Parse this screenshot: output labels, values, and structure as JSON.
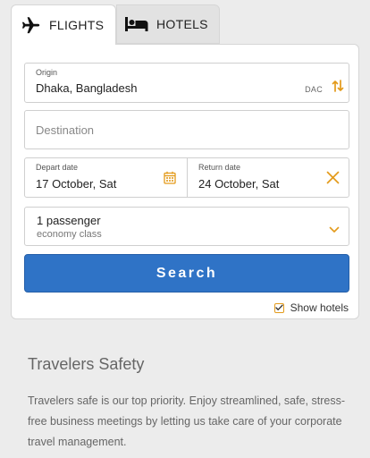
{
  "tabs": {
    "flights": {
      "label": "FLIGHTS",
      "icon": "airplane-icon"
    },
    "hotels": {
      "label": "HOTELS",
      "icon": "bed-icon"
    }
  },
  "origin": {
    "label": "Origin",
    "value": "Dhaka, Bangladesh",
    "code": "DAC",
    "swap_icon": "swap-arrows-icon"
  },
  "destination": {
    "placeholder": "Destination"
  },
  "dates": {
    "depart_label": "Depart date",
    "depart_value": "17 October, Sat",
    "return_label": "Return date",
    "return_value": "24 October, Sat"
  },
  "passengers": {
    "count": "1 passenger",
    "class": "economy class"
  },
  "search_button": "Search",
  "show_hotels": {
    "label": "Show hotels",
    "checked": true
  },
  "colors": {
    "accent": "#e39a1a",
    "primary": "#2f73c6"
  },
  "info": {
    "title": "Travelers Safety",
    "body": "Travelers safe is our top priority. Enjoy streamlined, safe, stress-free business meetings by letting us take care of your corporate travel management."
  }
}
